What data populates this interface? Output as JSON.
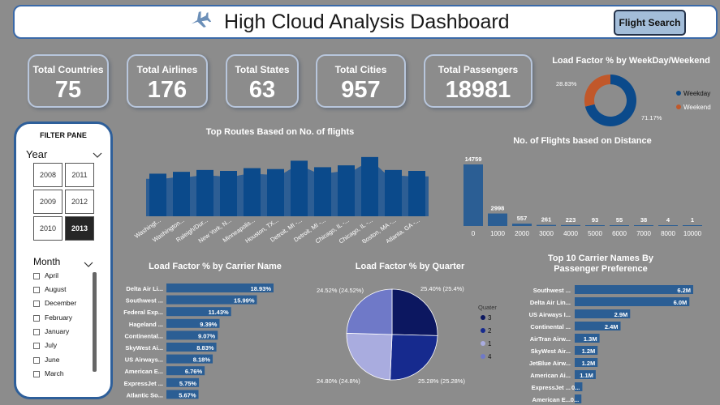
{
  "header": {
    "title": "High Cloud Analysis Dashboard",
    "button": "Flight Search"
  },
  "kpis": [
    {
      "label": "Total Countries",
      "value": "75"
    },
    {
      "label": "Total Airlines",
      "value": "176"
    },
    {
      "label": "Total States",
      "value": "63"
    },
    {
      "label": "Total Cities",
      "value": "957"
    },
    {
      "label": "Total Passengers",
      "value": "18981"
    }
  ],
  "filter": {
    "title": "FILTER PANE",
    "year_label": "Year",
    "years": [
      "2008",
      "2011",
      "2009",
      "2012",
      "2010",
      "2013"
    ],
    "selected_year": "2013",
    "month_label": "Month",
    "months": [
      "April",
      "August",
      "December",
      "February",
      "January",
      "July",
      "June",
      "March"
    ]
  },
  "colors": {
    "dark_blue": "#0b4a8b",
    "mid_blue": "#2b5e94",
    "orange": "#c1582a"
  },
  "charts": {
    "routes": {
      "type": "bar",
      "title": "Top Routes Based on No. of flights",
      "categories": [
        "Washingt...",
        "Washington...",
        "Raleigh/Dur...",
        "New York, N...",
        "Minneapolis...",
        "Houston, TX...",
        "Detroit, MI -...",
        "Detroit, MI -...",
        "Chicago, IL -...",
        "Chicago, IL -...",
        "Boston, MA -...",
        "Atlanta, GA -..."
      ],
      "values": [
        46,
        48,
        50,
        49,
        52,
        51,
        60,
        53,
        55,
        64,
        50,
        49
      ],
      "ylim": [
        0,
        70
      ]
    },
    "distance": {
      "type": "bar",
      "title": "No. of Flights based on Distance",
      "categories": [
        "0",
        "1000",
        "2000",
        "3000",
        "4000",
        "5000",
        "6000",
        "7000",
        "8000",
        "10000"
      ],
      "values": [
        14759,
        2998,
        557,
        261,
        223,
        93,
        55,
        38,
        4,
        1
      ]
    },
    "weekday": {
      "type": "pie",
      "title": "Load Factor % by WeekDay/Weekend",
      "labels": [
        "Weekday",
        "Weekend"
      ],
      "values": [
        71.17,
        28.83
      ],
      "value_labels": [
        "71.17%",
        "28.83%"
      ],
      "legend": "right"
    },
    "carrier_lf": {
      "type": "bar",
      "title": "Load Factor % by Carrier Name",
      "categories": [
        "Delta Air Li...",
        "Southwest ...",
        "Federal Exp...",
        "Hageland ...",
        "Continental...",
        "SkyWest Ai...",
        "US Airways...",
        "American E...",
        "ExpressJet ...",
        "Atlantic So..."
      ],
      "values": [
        18.93,
        15.99,
        11.43,
        9.39,
        9.07,
        8.83,
        8.18,
        6.76,
        5.75,
        5.67
      ],
      "value_labels": [
        "18.93%",
        "15.99%",
        "11.43%",
        "9.39%",
        "9.07%",
        "8.83%",
        "8.18%",
        "6.76%",
        "5.75%",
        "5.67%"
      ]
    },
    "quarter": {
      "type": "pie",
      "title": "Load Factor % by Quarter",
      "legend_title": "Quater",
      "labels": [
        "3",
        "2",
        "1",
        "4"
      ],
      "values": [
        25.4,
        25.28,
        24.8,
        24.52
      ],
      "value_labels": [
        "25.40% (25.4%)",
        "25.28% (25.28%)",
        "24.80% (24.8%)",
        "24.52% (24.52%)"
      ],
      "colors": [
        "#0c1760",
        "#162a8e",
        "#a9acdf",
        "#6f79c8"
      ],
      "legend": "right"
    },
    "passengers": {
      "type": "bar",
      "title": "Top 10 Carrier Names By Passenger Preference",
      "categories": [
        "Southwest ...",
        "Delta Air Lin...",
        "US Airways I...",
        "Continental ...",
        "AirTran Airw...",
        "SkyWest Air...",
        "JetBlue Airw...",
        "American Ai...",
        "ExpressJet ...",
        "American E..."
      ],
      "values": [
        6.2,
        6.0,
        2.9,
        2.4,
        1.3,
        1.2,
        1.2,
        1.1,
        0.4,
        0.35
      ],
      "value_labels": [
        "6.2M",
        "6.0M",
        "2.9M",
        "2.4M",
        "1.3M",
        "1.2M",
        "1.2M",
        "1.1M",
        "0...",
        "0..."
      ]
    }
  }
}
